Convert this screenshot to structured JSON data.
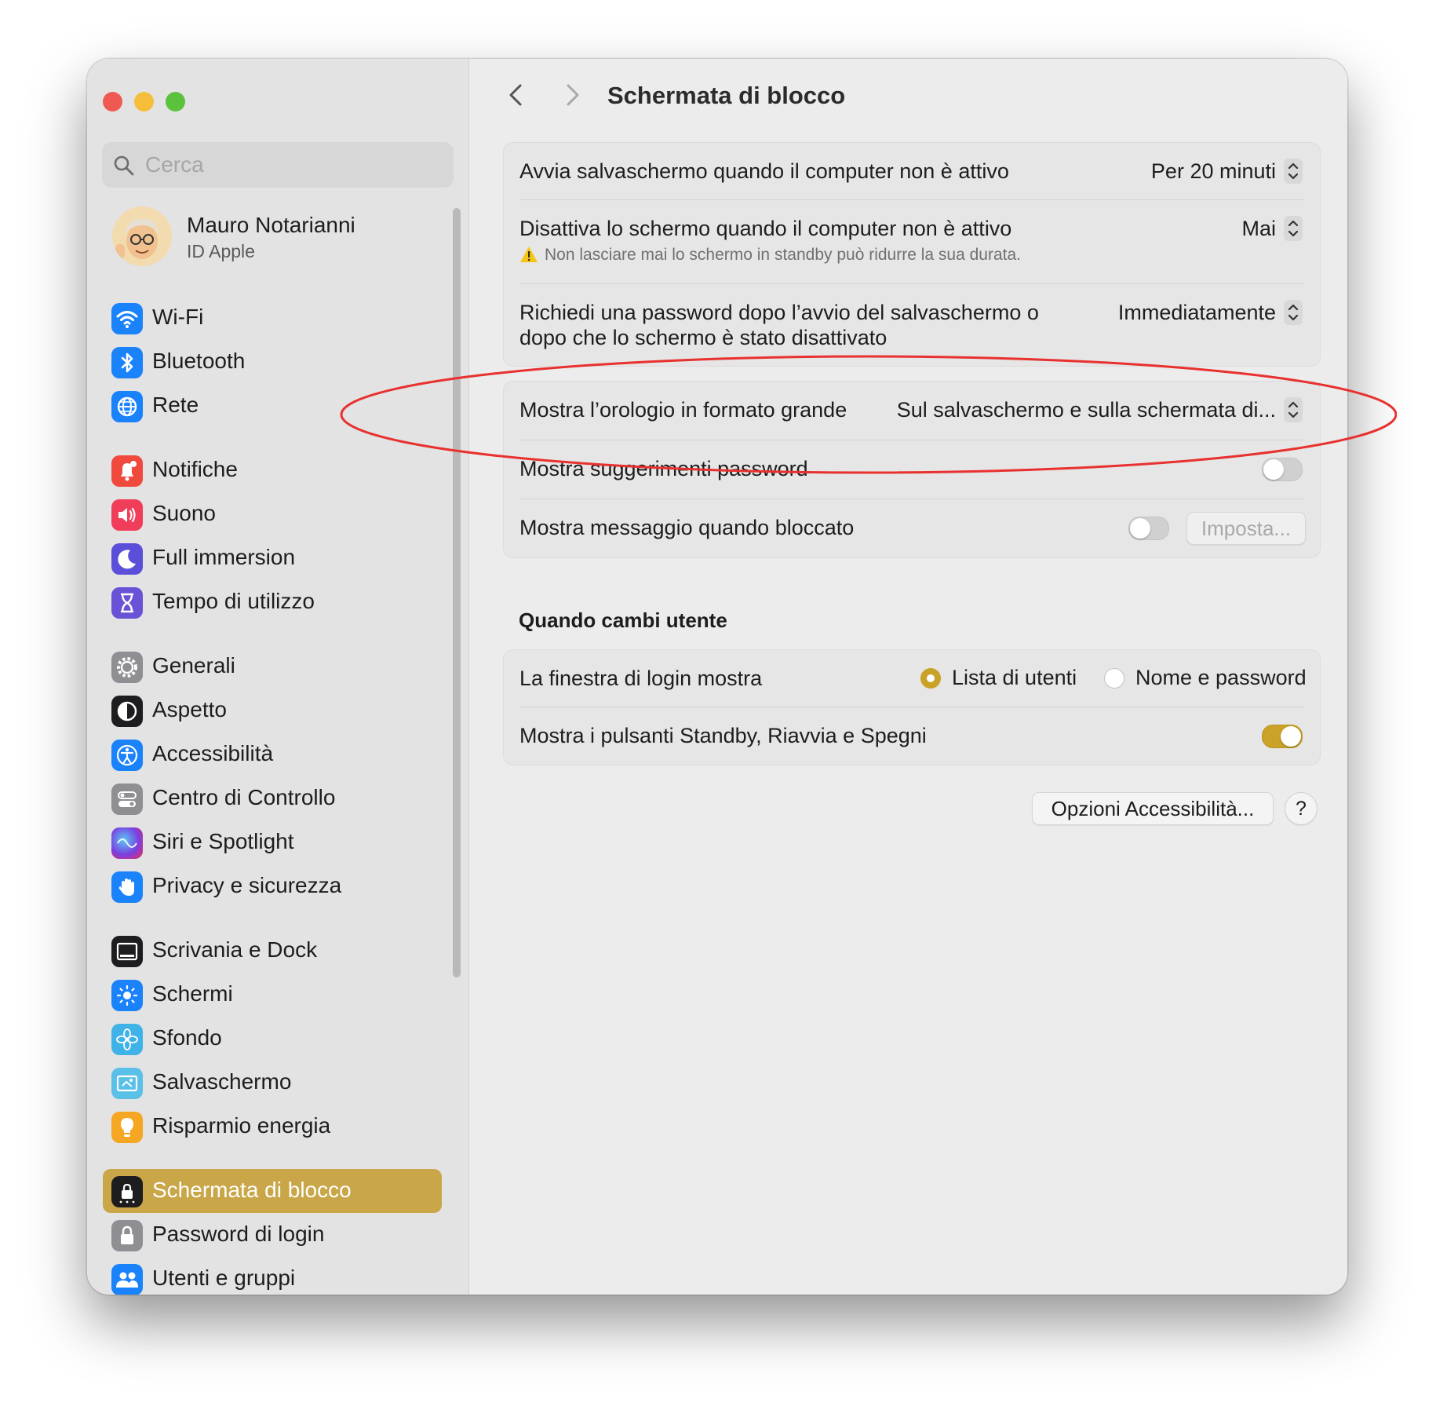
{
  "window": {
    "traffic_lights": {
      "close": "#ee5a52",
      "minimize": "#f6be3a",
      "zoom": "#5ac23d"
    }
  },
  "sidebar": {
    "search_placeholder": "Cerca",
    "profile": {
      "name": "Mauro Notarianni",
      "subtitle": "ID Apple"
    },
    "items": [
      {
        "label": "Wi-Fi",
        "icon": "wifi-icon",
        "color": "#1a82fb"
      },
      {
        "label": "Bluetooth",
        "icon": "bluetooth-icon",
        "color": "#1a82fb"
      },
      {
        "label": "Rete",
        "icon": "globe-icon",
        "color": "#1a82fb"
      },
      {
        "label": "Notifiche",
        "icon": "bell-icon",
        "color": "#f04a3e"
      },
      {
        "label": "Suono",
        "icon": "speaker-icon",
        "color": "#f03e5a"
      },
      {
        "label": "Full immersion",
        "icon": "moon-icon",
        "color": "#5b4fd9"
      },
      {
        "label": "Tempo di utilizzo",
        "icon": "hourglass-icon",
        "color": "#6a52d6"
      },
      {
        "label": "Generali",
        "icon": "gear-icon",
        "color": "#8e8e93"
      },
      {
        "label": "Aspetto",
        "icon": "appearance-icon",
        "color": "#1d1d1f"
      },
      {
        "label": "Accessibilità",
        "icon": "accessibility-icon",
        "color": "#1a82fb"
      },
      {
        "label": "Centro di Controllo",
        "icon": "control-center-icon",
        "color": "#8e8e93"
      },
      {
        "label": "Siri e Spotlight",
        "icon": "siri-icon",
        "color": "#c03aa8"
      },
      {
        "label": "Privacy e sicurezza",
        "icon": "hand-icon",
        "color": "#1a82fb"
      },
      {
        "label": "Scrivania e Dock",
        "icon": "dock-icon",
        "color": "#1d1d1f"
      },
      {
        "label": "Schermi",
        "icon": "sun-icon",
        "color": "#1a82fb"
      },
      {
        "label": "Sfondo",
        "icon": "flower-icon",
        "color": "#3fb3e8"
      },
      {
        "label": "Salvaschermo",
        "icon": "screensaver-icon",
        "color": "#5ac0e8"
      },
      {
        "label": "Risparmio energia",
        "icon": "bulb-icon",
        "color": "#f5a623"
      },
      {
        "label": "Schermata di blocco",
        "icon": "lock-screen-icon",
        "color": "#1d1d1f"
      },
      {
        "label": "Password di login",
        "icon": "lock-icon",
        "color": "#8e8e93"
      },
      {
        "label": "Utenti e gruppi",
        "icon": "users-icon",
        "color": "#1a82fb"
      }
    ],
    "selected": "Schermata di blocco",
    "accent": "#c9a648"
  },
  "main": {
    "title": "Schermata di blocco",
    "rows": {
      "screensaver": {
        "label": "Avvia salvaschermo quando il computer non è attivo",
        "value": "Per 20 minuti"
      },
      "display_off": {
        "label": "Disattiva lo schermo quando il computer non è attivo",
        "value": "Mai",
        "note": "Non lasciare mai lo schermo in standby può ridurre la sua durata."
      },
      "password": {
        "label_line1": "Richiedi una password dopo l’avvio del salvaschermo o",
        "label_line2": "dopo che lo schermo è stato disattivato",
        "value": "Immediatamente"
      },
      "big_clock": {
        "label": "Mostra l’orologio in formato grande",
        "value": "Sul salvaschermo e sulla schermata di..."
      },
      "password_hints": {
        "label": "Mostra suggerimenti password",
        "enabled": false
      },
      "lock_message": {
        "label": "Mostra messaggio quando bloccato",
        "enabled": false,
        "button": "Imposta..."
      }
    },
    "switch_user": {
      "heading": "Quando cambi utente",
      "login_window": {
        "label": "La finestra di login mostra",
        "options": [
          "Lista di utenti",
          "Nome e password"
        ],
        "selected": "Lista di utenti"
      },
      "power_buttons": {
        "label": "Mostra i pulsanti Standby, Riavvia e Spegni",
        "enabled": true
      }
    },
    "accessibility_button": "Opzioni Accessibilità...",
    "help_button": "?",
    "highlight_color": "#e8312f",
    "toggle_on_color": "#c9a227"
  }
}
